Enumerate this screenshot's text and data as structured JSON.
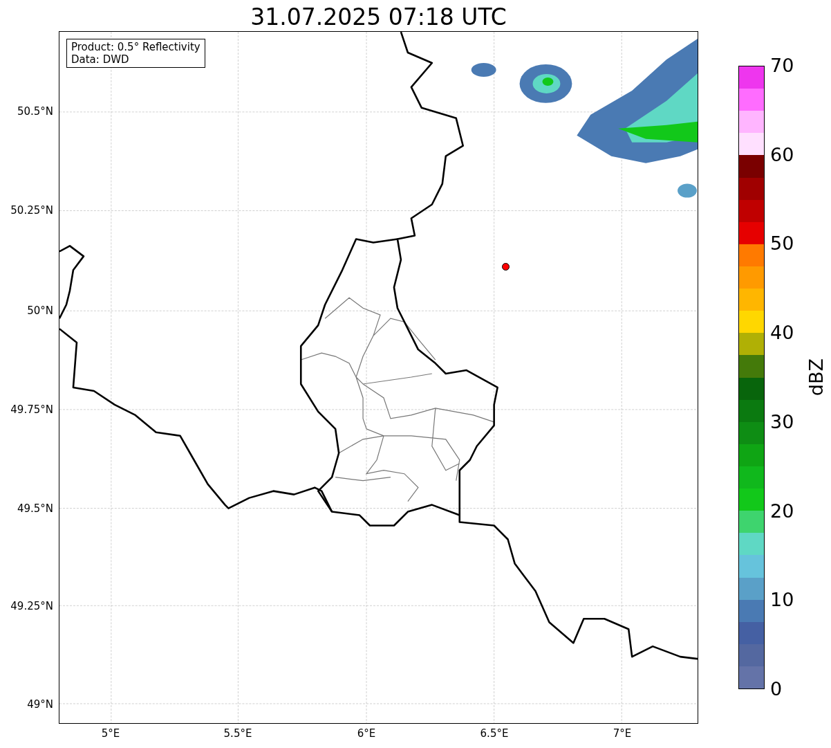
{
  "title": "31.07.2025 07:18 UTC",
  "info_box": [
    "Product: 0.5° Reflectivity",
    "Data: DWD"
  ],
  "map": {
    "lat_ticks": [
      "50.5°N",
      "50.25°N",
      "50°N",
      "49.75°N",
      "49.5°N",
      "49.25°N",
      "49°N"
    ],
    "lon_ticks": [
      "5°E",
      "5.5°E",
      "6°E",
      "6.5°E",
      "7°E"
    ]
  },
  "colorbar": {
    "label": "dBZ",
    "ticks": [
      "70",
      "60",
      "50",
      "40",
      "30",
      "20",
      "10",
      "0"
    ],
    "bands": [
      {
        "color": "#6473a8"
      },
      {
        "color": "#5468a0"
      },
      {
        "color": "#4560a3"
      },
      {
        "color": "#4a7ab3"
      },
      {
        "color": "#5aa0c8"
      },
      {
        "color": "#66c3dc"
      },
      {
        "color": "#5fd8c4"
      },
      {
        "color": "#3ed46e"
      },
      {
        "color": "#12c81a"
      },
      {
        "color": "#10b81c"
      },
      {
        "color": "#0fa514"
      },
      {
        "color": "#0e8d14"
      },
      {
        "color": "#0b7a10"
      },
      {
        "color": "#08650c"
      },
      {
        "color": "#447a0a"
      },
      {
        "color": "#b0b005"
      },
      {
        "color": "#ffd700"
      },
      {
        "color": "#ffb600"
      },
      {
        "color": "#ff9a00"
      },
      {
        "color": "#ff7a00"
      },
      {
        "color": "#e60000"
      },
      {
        "color": "#c00000"
      },
      {
        "color": "#a00000"
      },
      {
        "color": "#7a0000"
      },
      {
        "color": "#ffe0ff"
      },
      {
        "color": "#ffb5ff"
      },
      {
        "color": "#ff6cff"
      },
      {
        "color": "#ee36ee"
      }
    ]
  }
}
